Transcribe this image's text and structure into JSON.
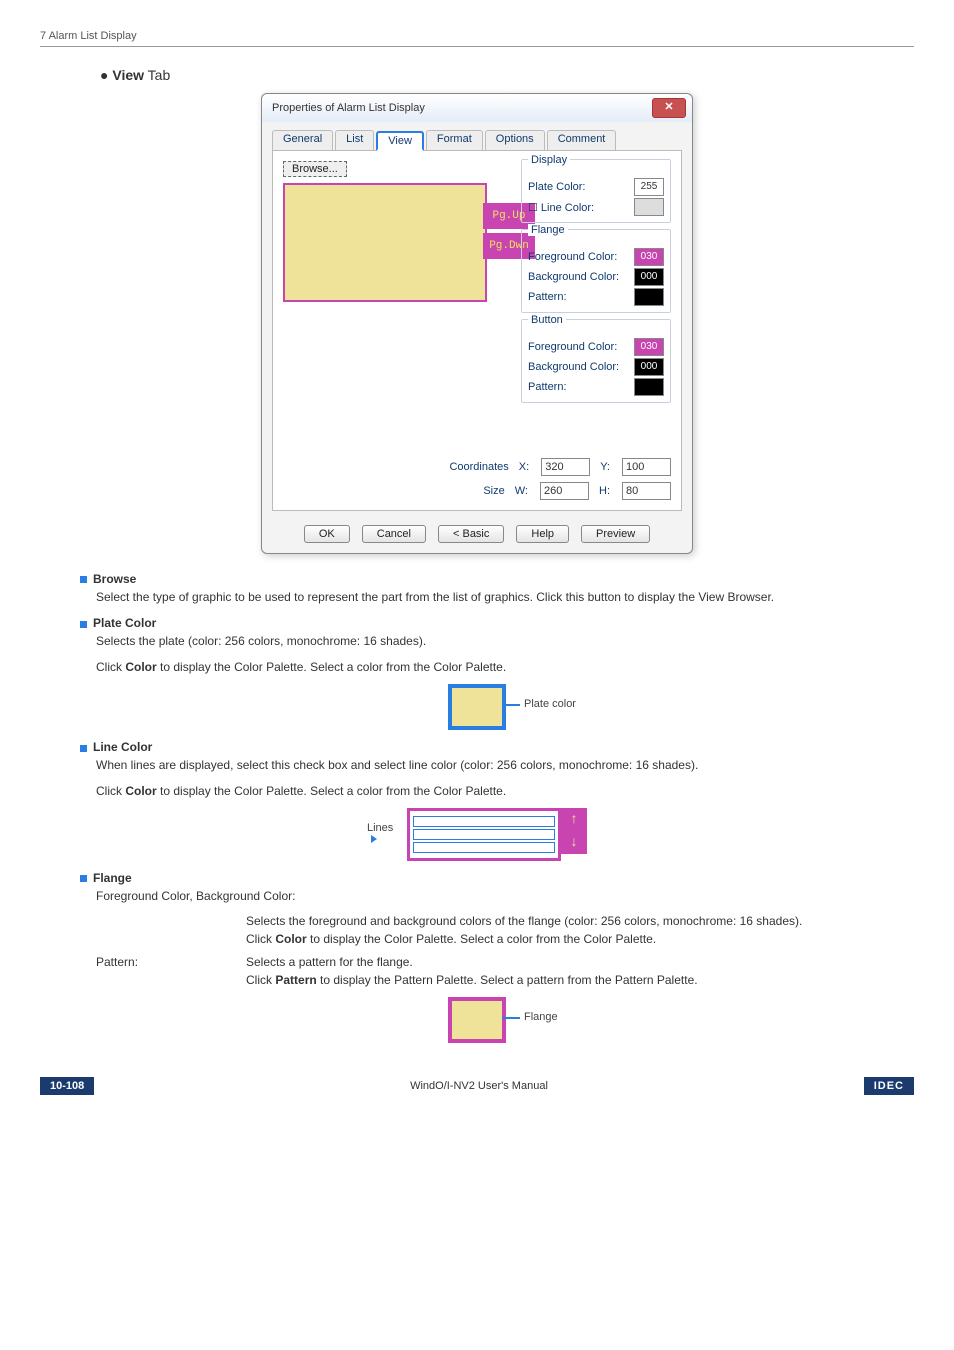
{
  "header": "7 Alarm List Display",
  "section": {
    "bullet": "●",
    "title_bold": "View",
    "title_rest": " Tab"
  },
  "dialog": {
    "title": "Properties of Alarm List Display",
    "close": "✕",
    "tabs": {
      "general": "General",
      "list": "List",
      "view": "View",
      "format": "Format",
      "options": "Options",
      "comment": "Comment"
    },
    "browse": "Browse...",
    "pg_up": "Pg.Up",
    "pg_dn": "Pg.Dwn",
    "groups": {
      "display": {
        "legend": "Display",
        "plate_color": "Plate Color:",
        "plate_val": "255",
        "line_color": "Line Color:"
      },
      "flange": {
        "legend": "Flange",
        "fg": "Foreground Color:",
        "fg_val": "030",
        "bg": "Background Color:",
        "bg_val": "000",
        "pattern": "Pattern:"
      },
      "button": {
        "legend": "Button",
        "fg": "Foreground Color:",
        "fg_val": "030",
        "bg": "Background Color:",
        "bg_val": "000",
        "pattern": "Pattern:"
      }
    },
    "coords_label": "Coordinates",
    "size_label": "Size",
    "x_label": "X:",
    "x_val": "320",
    "y_label": "Y:",
    "y_val": "100",
    "w_label": "W:",
    "w_val": "260",
    "h_label": "H:",
    "h_val": "80",
    "buttons": {
      "ok": "OK",
      "cancel": "Cancel",
      "basic": "< Basic",
      "help": "Help",
      "preview": "Preview"
    }
  },
  "sections": {
    "browse": {
      "title": "Browse",
      "body": "Select the type of graphic to be used to represent the part from the list of graphics. Click this button to display the View Browser."
    },
    "plate": {
      "title": "Plate Color",
      "body1": "Selects the plate (color: 256 colors, monochrome: 16 shades).",
      "body2a": "Click ",
      "body2b": "Color",
      "body2c": " to display the Color Palette. Select a color from the Color Palette.",
      "fig_label": "Plate color"
    },
    "line": {
      "title": "Line Color",
      "body1": "When lines are displayed, select this check box and select line color (color: 256 colors, monochrome: 16 shades).",
      "body2a": "Click ",
      "body2b": "Color",
      "body2c": " to display the Color Palette. Select a color from the Color Palette.",
      "fig_label": "Lines",
      "up": "↑",
      "dn": "↓"
    },
    "flange": {
      "title": "Flange",
      "row1_label": "Foreground Color, Background Color:",
      "row1_body": "Selects the foreground and background colors of the flange (color: 256 colors, monochrome: 16 shades).",
      "row1_body2a": "Click ",
      "row1_body2b": "Color",
      "row1_body2c": " to display the Color Palette. Select a color from the Color Palette.",
      "row2_label": "Pattern:",
      "row2_body": "Selects a pattern for the flange.",
      "row2_body2a": "Click ",
      "row2_body2b": "Pattern",
      "row2_body2c": " to display the Pattern Palette. Select a pattern from the Pattern Palette.",
      "fig_label": "Flange"
    }
  },
  "footer": {
    "pnum": "10-108",
    "center": "WindO/I-NV2 User's Manual",
    "brand": "IDEC"
  }
}
